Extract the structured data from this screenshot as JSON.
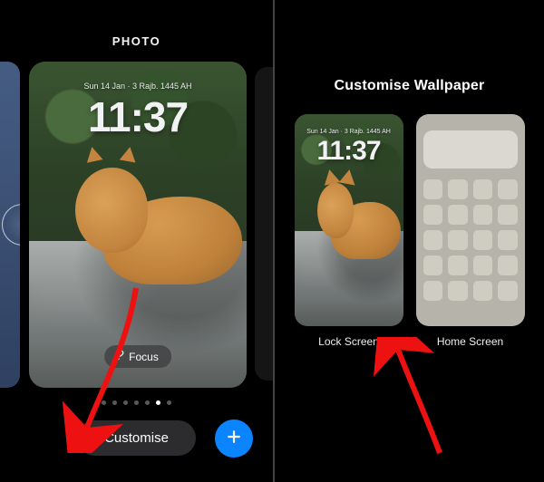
{
  "left": {
    "title": "PHOTO",
    "date": "Sun 14 Jan · 3 Rajb. 1445 AH",
    "time": "11:37",
    "focus_label": "Focus",
    "customise_label": "Customise",
    "page_count": 7,
    "page_active_index": 5
  },
  "right": {
    "title": "Customise Wallpaper",
    "lock": {
      "date": "Sun 14 Jan · 3 Rajb. 1445 AH",
      "time": "11:37",
      "label": "Lock Screen"
    },
    "home": {
      "label": "Home Screen"
    }
  },
  "colors": {
    "accent_blue": "#0a84ff",
    "arrow_red": "#e11"
  }
}
